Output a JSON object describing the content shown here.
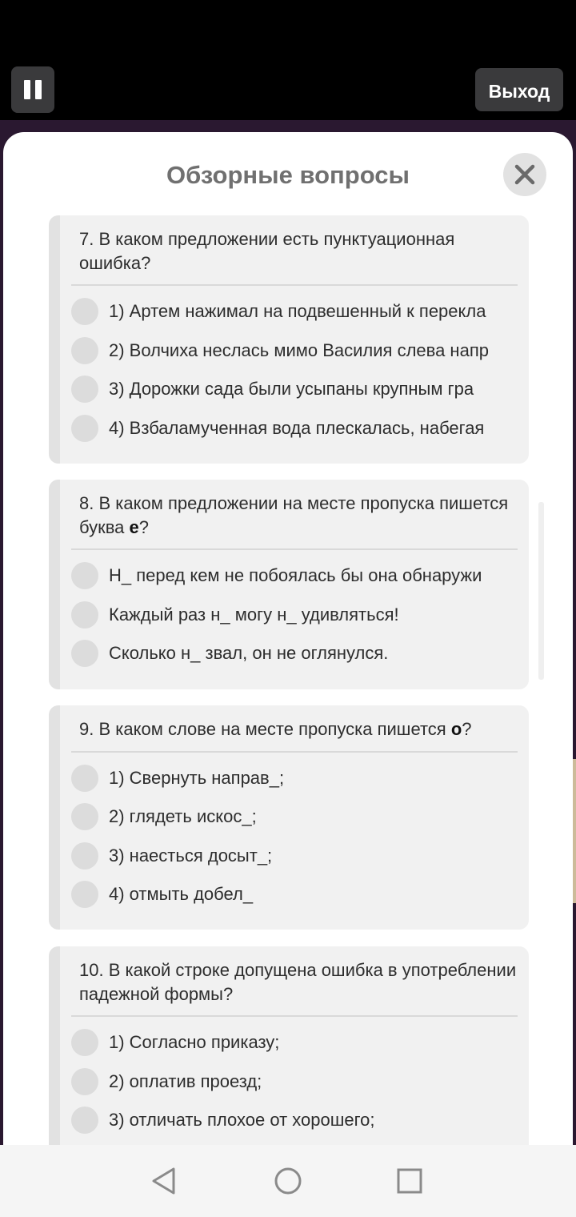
{
  "header": {
    "exit_label": "Выход"
  },
  "modal": {
    "title": "Обзорные вопросы",
    "questions": [
      {
        "number": "7.",
        "text_before": "В каком предложении есть пунктуационная ошибка?",
        "options": [
          "1) Артем нажимал на подвешенный к перекла",
          "2) Волчиха неслась мимо Василия слева напр",
          "3) Дорожки сада были усыпаны крупным гра",
          "4) Взбаламученная вода плескалась, набегая"
        ]
      },
      {
        "number": "8.",
        "text_before": "В каком предложении на месте пропуска пишется буква ",
        "bold": "е",
        "text_after": "?",
        "options": [
          "Н_ перед кем не побоялась бы она обнаружи",
          "Каждый раз н_ могу н_ удивляться!",
          "Сколько н_ звал, он не оглянулся."
        ]
      },
      {
        "number": "9.",
        "text_before": "В каком слове на месте пропуска пишется ",
        "bold": "о",
        "text_after": "?",
        "options": [
          "1) Свернуть направ_;",
          "2) глядеть искос_;",
          "3) наесться досыт_;",
          "4) отмыть добел_"
        ]
      },
      {
        "number": "10.",
        "text_before": "В какой строке допущена ошибка в употреблении падежной формы?",
        "options": [
          "1) Согласно приказу;",
          "2) оплатив проезд;",
          "3) отличать плохое от хорошего;"
        ]
      }
    ]
  },
  "icons": {
    "pause": "pause-icon",
    "close": "close-icon",
    "nav_back": "back-triangle-icon",
    "nav_home": "home-circle-icon",
    "nav_recents": "recents-square-icon"
  },
  "colors": {
    "modal_bg": "#ffffff",
    "card_bg": "#f1f1f1",
    "title_gray": "#707070",
    "app_bg": "#2a1830"
  }
}
